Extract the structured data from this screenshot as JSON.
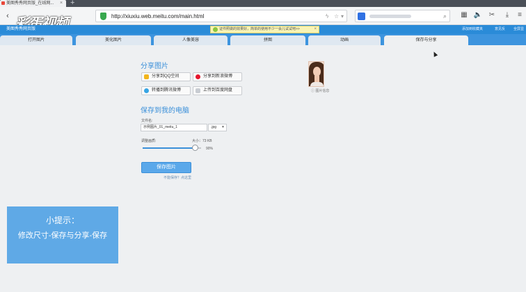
{
  "browser": {
    "tab_title": "美图秀秀网页版_在线网...",
    "tab_close": "×",
    "new_tab": "+",
    "url": "http://xiuxiu.web.meitu.com/main.html",
    "nav_back": "‹",
    "nav_refresh": "↻",
    "nav_home": "⌂",
    "nav_fav": "☆",
    "icon_star": "☆",
    "icon_down": "▾",
    "icon_search": "⌕"
  },
  "watermark": {
    "text": "彩蛋视频"
  },
  "bookmark_bar": {
    "item": "美图秀秀网页版",
    "notice": "证件照做的效果好，简单的使用不少一会儿试试吧>>",
    "notice_close": "×",
    "link_1": "添加到收藏夹",
    "link_2": "意见反",
    "link_3": "全屏显"
  },
  "tool_tabs": [
    {
      "label": "打开图片",
      "active": false
    },
    {
      "label": "美化图片",
      "active": false
    },
    {
      "label": "人像美容",
      "active": false
    },
    {
      "label": "拼图",
      "active": false
    },
    {
      "label": "动画",
      "active": false
    },
    {
      "label": "保存与分享",
      "active": true
    }
  ],
  "share": {
    "title": "分享图片",
    "btn_qq": "分享到QQ空间",
    "btn_sina": "分享到新浪微博",
    "btn_tencent": "转播到腾讯微博",
    "btn_baidu": "上传到百度网盘"
  },
  "save": {
    "title": "保存到我的电脑",
    "filename_label": "文件名:",
    "filename_value": "示例图片_01_meitu_1",
    "format_value": ".jpg",
    "quality_label": "调整画质:",
    "size_text": "大小：73 KB",
    "quality_value": "90%",
    "quality_fraction": 0.9,
    "save_button": "保存图片",
    "help_text": "不能保存？点这里"
  },
  "preview": {
    "label": "图片信息"
  },
  "tip": {
    "title": "小提示：",
    "body": "修改尺寸-保存与分享-保存"
  },
  "colors": {
    "accent": "#3a8fd9",
    "tab_bar": "#3d94de",
    "tip_bg": "#5fa9e6"
  }
}
